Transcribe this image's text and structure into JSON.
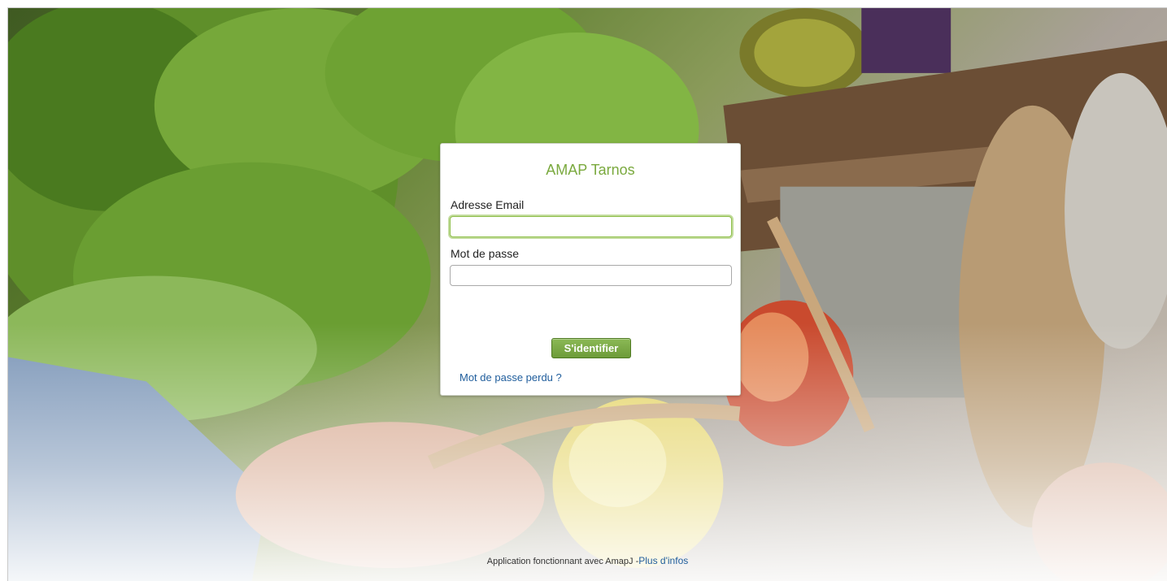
{
  "login": {
    "title": "AMAP Tarnos",
    "email_label": "Adresse Email",
    "email_value": "",
    "password_label": "Mot de passe",
    "password_value": "",
    "submit_label": "S'identifier",
    "lost_password_link": "Mot de passe perdu ?"
  },
  "footer": {
    "text": "Application fonctionnant avec AmapJ -",
    "link": "Plus d'infos"
  },
  "colors": {
    "accent": "#7aa93e",
    "button": "#6d9b39",
    "link": "#1f5d9c"
  }
}
